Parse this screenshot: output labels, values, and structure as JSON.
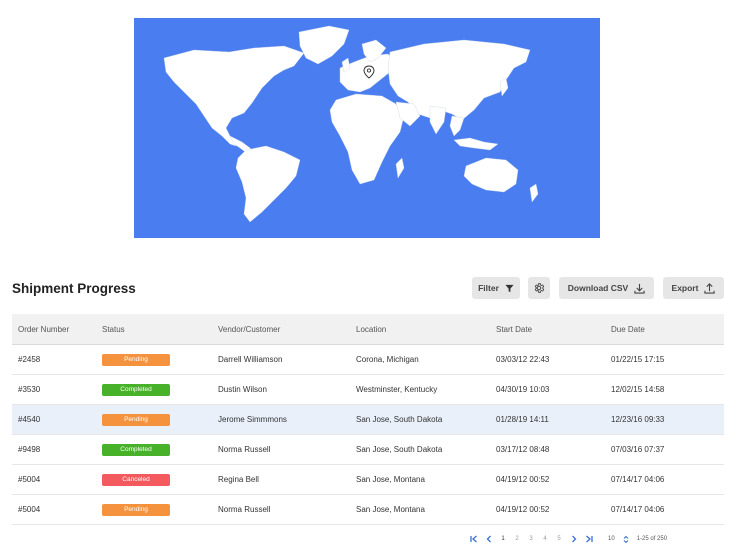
{
  "colors": {
    "map_ocean": "#4a7ef0",
    "pending": "#f4923e",
    "completed": "#47b12a",
    "canceled": "#f25a5e",
    "pager_icon": "#3d6fd6"
  },
  "map": {
    "marker_icon": "map-pin-icon"
  },
  "header": {
    "title": "Shipment Progress",
    "filter_label": "Filter",
    "download_label": "Download CSV",
    "export_label": "Export"
  },
  "table": {
    "columns": [
      "Order Number",
      "Status",
      "Vendor/Customer",
      "Location",
      "Start Date",
      "Due Date"
    ],
    "rows": [
      {
        "order": "#2458",
        "status": "Pending",
        "status_type": "pending",
        "customer": "Darrell Williamson",
        "location": "Corona, Michigan",
        "start": "03/03/12 22:43",
        "due": "01/22/15 17:15"
      },
      {
        "order": "#3530",
        "status": "Completed",
        "status_type": "completed",
        "customer": "Dustin Wilson",
        "location": "Westminster, Kentucky",
        "start": "04/30/19 10:03",
        "due": "12/02/15 14:58"
      },
      {
        "order": "#4540",
        "status": "Pending",
        "status_type": "pending",
        "customer": "Jerome Simmmons",
        "location": "San Jose, South Dakota",
        "start": "01/28/19 14:11",
        "due": "12/23/16 09:33"
      },
      {
        "order": "#9498",
        "status": "Completed",
        "status_type": "completed",
        "customer": "Norma Russell",
        "location": "San Jose, South Dakota",
        "start": "03/17/12 08:48",
        "due": "07/03/16 07:37"
      },
      {
        "order": "#5004",
        "status": "Canceled",
        "status_type": "canceled",
        "customer": "Regina Bell",
        "location": "San Jose, Montana",
        "start": "04/19/12 00:52",
        "due": "07/14/17 04:06"
      },
      {
        "order": "#5004",
        "status": "Pending",
        "status_type": "pending",
        "customer": "Norma Russell",
        "location": "San Jose, Montana",
        "start": "04/19/12 00:52",
        "due": "07/14/17 04:06"
      }
    ]
  },
  "pagination": {
    "pages": [
      "1",
      "2",
      "3",
      "4",
      "5"
    ],
    "current_page": "1",
    "per_page": "10",
    "range": "1-25 of 250"
  }
}
